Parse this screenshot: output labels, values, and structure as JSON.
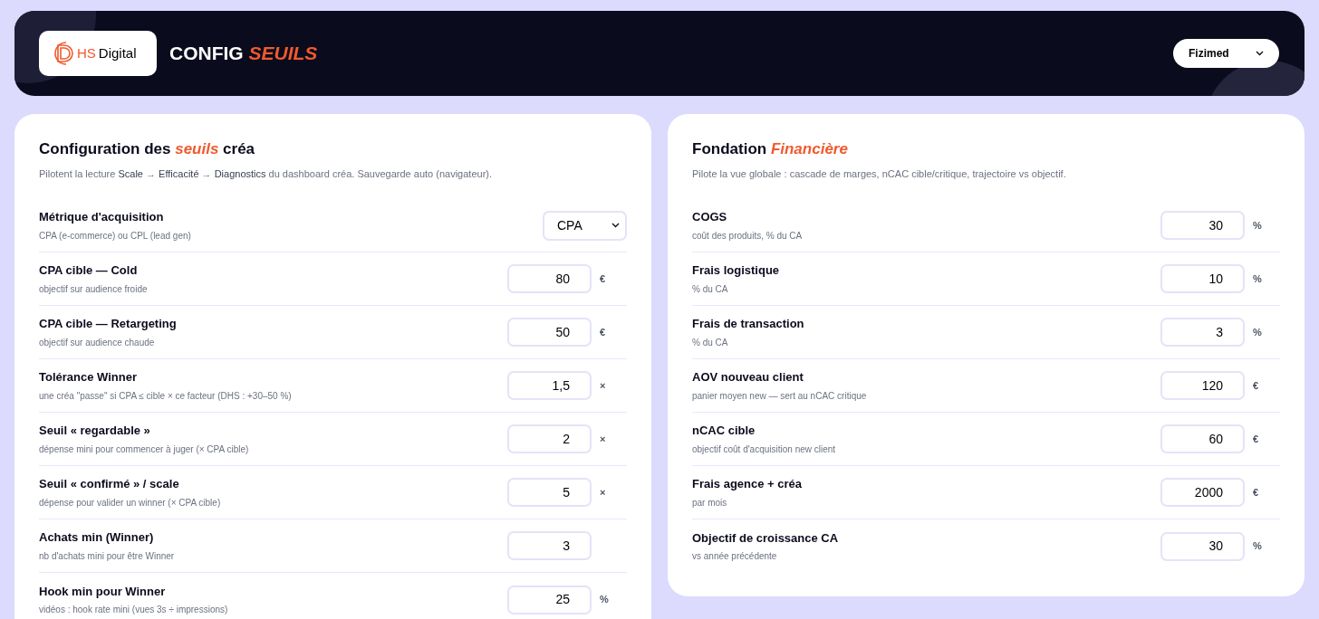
{
  "header": {
    "logo": {
      "mark": "HS",
      "name": "Digital"
    },
    "title": "CONFIG *SEUILS*",
    "client_select": {
      "value": "Fizimed"
    }
  },
  "panels": [
    {
      "title": "Configuration des *seuils* créa",
      "subtitle": "Pilotent la lecture **Scale** → **Efficacité** → **Diagnostics** du dashboard créa. Sauvegarde auto (navigateur).",
      "rows": [
        {
          "kind": "select",
          "label": "Métrique d'acquisition",
          "hint": "CPA (e-commerce) ou CPL (lead gen)",
          "value": "CPA"
        },
        {
          "kind": "number",
          "label": "CPA cible — Cold",
          "hint": "objectif sur audience froide",
          "value": "80",
          "unit": "€"
        },
        {
          "kind": "number",
          "label": "CPA cible — Retargeting",
          "hint": "objectif sur audience chaude",
          "value": "50",
          "unit": "€"
        },
        {
          "kind": "number",
          "label": "Tolérance Winner",
          "hint": "une créa \"passe\" si CPA ≤ cible × ce facteur (DHS : +30–50 %)",
          "value": "1,5",
          "unit": "×"
        },
        {
          "kind": "number",
          "label": "Seuil « regardable »",
          "hint": "dépense mini pour commencer à juger (× CPA cible)",
          "value": "2",
          "unit": "×"
        },
        {
          "kind": "number",
          "label": "Seuil « confirmé » / scale",
          "hint": "dépense pour valider un winner (× CPA cible)",
          "value": "5",
          "unit": "×"
        },
        {
          "kind": "number",
          "label": "Achats min (Winner)",
          "hint": "nb d'achats mini pour être Winner",
          "value": "3"
        },
        {
          "kind": "number",
          "label": "Hook min pour Winner",
          "hint": "vidéos : hook rate mini (vues 3s ÷ impressions)",
          "value": "25",
          "unit": "%"
        }
      ]
    },
    {
      "title": "Fondation *Financière*",
      "subtitle": "Pilote la vue globale : cascade de marges, nCAC cible/critique, trajectoire vs objectif.",
      "rows": [
        {
          "kind": "number",
          "label": "COGS",
          "hint": "coût des produits, % du CA",
          "value": "30",
          "unit": "%"
        },
        {
          "kind": "number",
          "label": "Frais logistique",
          "hint": "% du CA",
          "value": "10",
          "unit": "%"
        },
        {
          "kind": "number",
          "label": "Frais de transaction",
          "hint": "% du CA",
          "value": "3",
          "unit": "%"
        },
        {
          "kind": "number",
          "label": "AOV nouveau client",
          "hint": "panier moyen new — sert au nCAC critique",
          "value": "120",
          "unit": "€"
        },
        {
          "kind": "number",
          "label": "nCAC cible",
          "hint": "objectif coût d'acquisition new client",
          "value": "60",
          "unit": "€"
        },
        {
          "kind": "number",
          "label": "Frais agence + créa",
          "hint": "par mois",
          "value": "2000",
          "unit": "€"
        },
        {
          "kind": "number",
          "label": "Objectif de croissance CA",
          "hint": "vs année précédente",
          "value": "30",
          "unit": "%"
        }
      ]
    }
  ]
}
